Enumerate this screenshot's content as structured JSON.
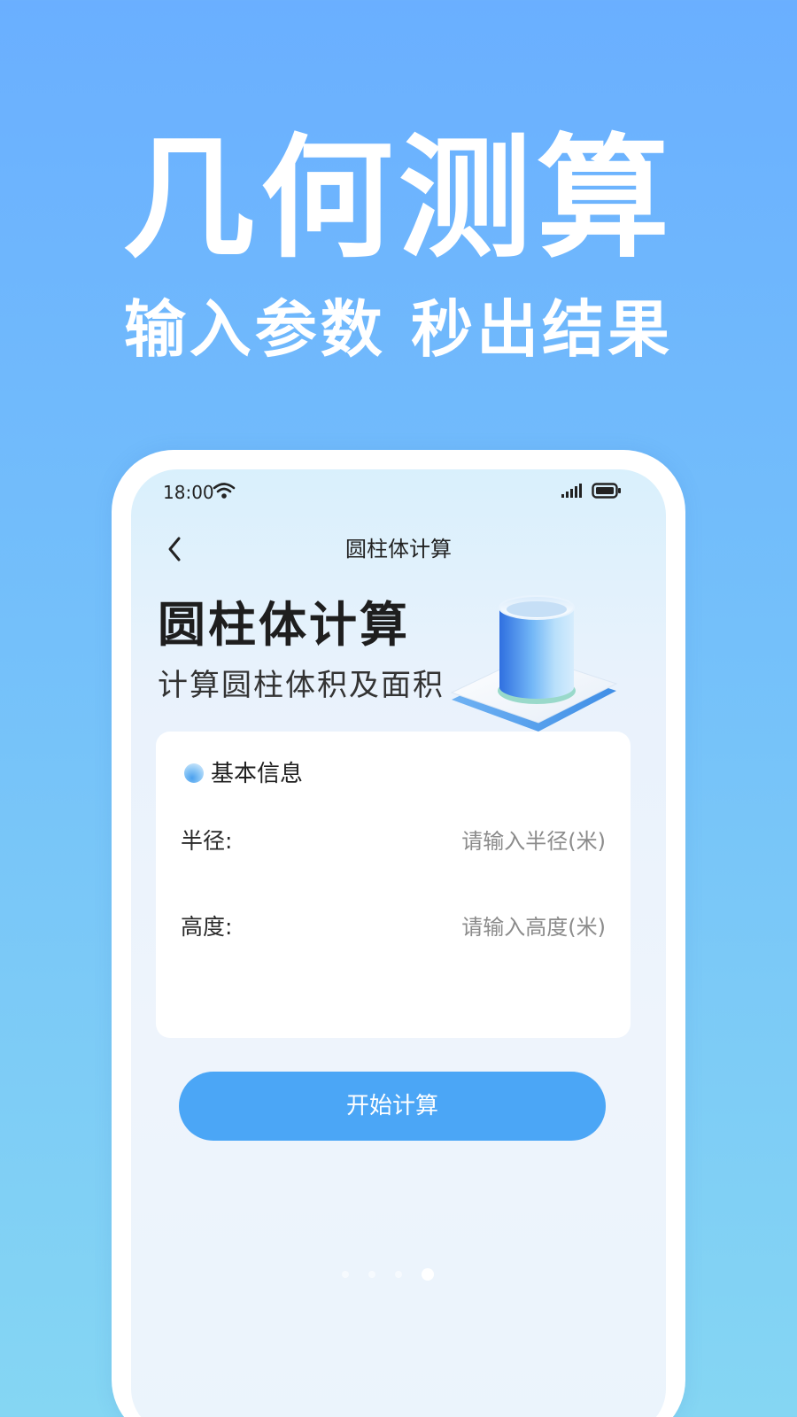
{
  "promo": {
    "title": "几何测算",
    "subtitle": "输入参数 秒出结果"
  },
  "status_bar": {
    "time": "18:00",
    "wifi_icon": "wifi-icon",
    "signal_icon": "cellular-signal-icon",
    "battery_icon": "battery-icon"
  },
  "nav": {
    "back_icon": "chevron-left-icon",
    "title": "圆柱体计算"
  },
  "hero": {
    "title": "圆柱体计算",
    "subtitle": "计算圆柱体积及面积",
    "illustration": "cylinder-illustration"
  },
  "form": {
    "section_title": "基本信息",
    "fields": [
      {
        "label": "半径:",
        "placeholder": "请输入半径(米)",
        "value": ""
      },
      {
        "label": "高度:",
        "placeholder": "请输入高度(米)",
        "value": ""
      }
    ],
    "submit_label": "开始计算"
  },
  "pager": {
    "count": 4,
    "active_index": 3
  },
  "colors": {
    "background_top": "#6aafff",
    "background_bottom": "#85d6f3",
    "button": "#4ba6f6",
    "card": "#ffffff"
  }
}
